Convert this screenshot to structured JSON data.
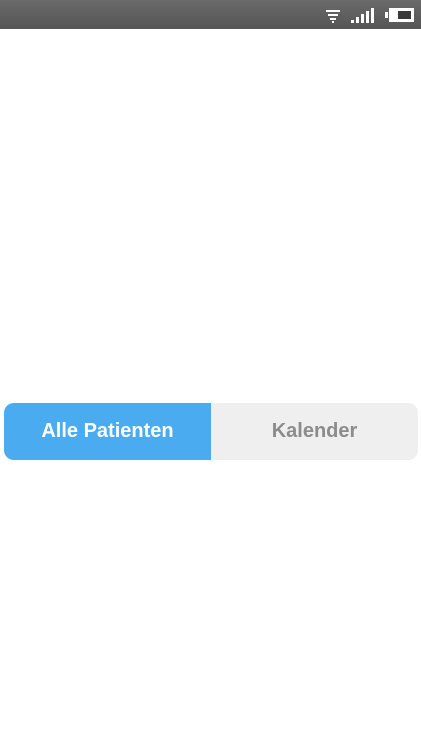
{
  "status_bar": {
    "icons": [
      "wifi-icon",
      "signal-icon",
      "battery-icon"
    ],
    "background": "#5e5e5e"
  },
  "segmented_control": {
    "active_color": "#4aabf0",
    "inactive_color": "#efefef",
    "segments": [
      {
        "label": "Alle Patienten",
        "selected": true
      },
      {
        "label": "Kalender",
        "selected": false
      }
    ]
  }
}
